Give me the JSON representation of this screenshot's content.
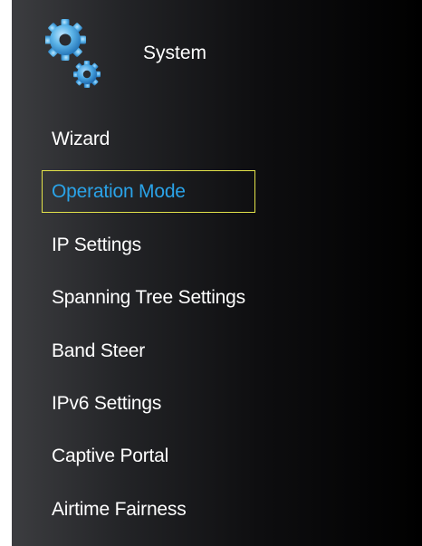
{
  "section": {
    "title": "System",
    "icon": "gears-icon"
  },
  "menu": {
    "active_index": 1,
    "items": [
      {
        "label": "Wizard"
      },
      {
        "label": "Operation Mode"
      },
      {
        "label": "IP Settings"
      },
      {
        "label": "Spanning Tree Settings"
      },
      {
        "label": "Band Steer"
      },
      {
        "label": "IPv6 Settings"
      },
      {
        "label": "Captive Portal"
      },
      {
        "label": "Airtime Fairness"
      }
    ]
  },
  "colors": {
    "active_text": "#2aa3e8",
    "active_outline": "#e3e34a",
    "text": "#ffffff"
  }
}
